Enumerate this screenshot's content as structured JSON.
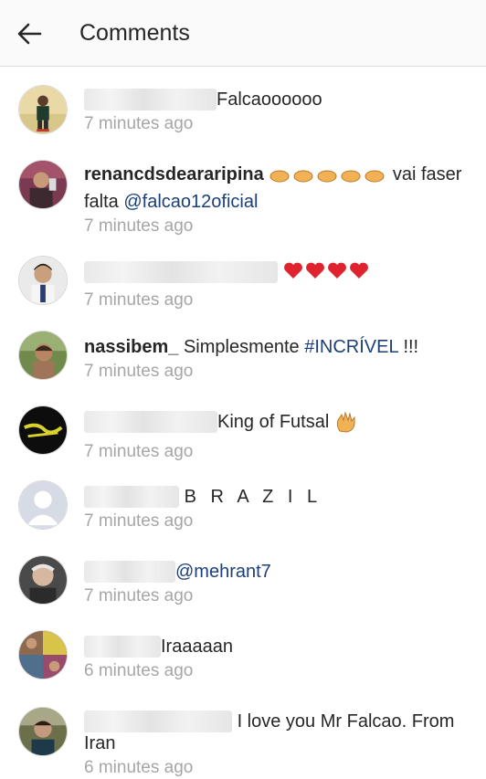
{
  "header": {
    "title": "Comments",
    "back_icon": "arrow-left-icon"
  },
  "comments": [
    {
      "user": "",
      "text": "Falcaoooooo",
      "time": "7 minutes ago"
    },
    {
      "user": "renancdsdeararipina",
      "text": "vai faser falta",
      "mention": "@falcao12oficial",
      "time": "7 minutes ago"
    },
    {
      "user": "",
      "text": "",
      "time": "7 minutes ago"
    },
    {
      "user": "nassibem_",
      "text": "Simplesmente",
      "hashtag": "#INCRÍVEL",
      "suffix": "!!!",
      "time": "7 minutes ago"
    },
    {
      "user": "",
      "text": "King of Futsal",
      "time": "7 minutes ago"
    },
    {
      "user": "",
      "text": "B R A Z I L",
      "time": "7 minutes ago"
    },
    {
      "user": "",
      "mention": "@mehrant7",
      "time": "7 minutes ago"
    },
    {
      "user": "",
      "text": "Iraaaaan",
      "time": "6 minutes ago"
    },
    {
      "user": "",
      "text": "I love you Mr Falcao.",
      "text2": "From Iran",
      "time": "6 minutes ago"
    }
  ],
  "colors": {
    "link": "#1c3f7a",
    "time": "#a6a6a6",
    "text": "#262626",
    "header_bg": "#fafafa"
  }
}
